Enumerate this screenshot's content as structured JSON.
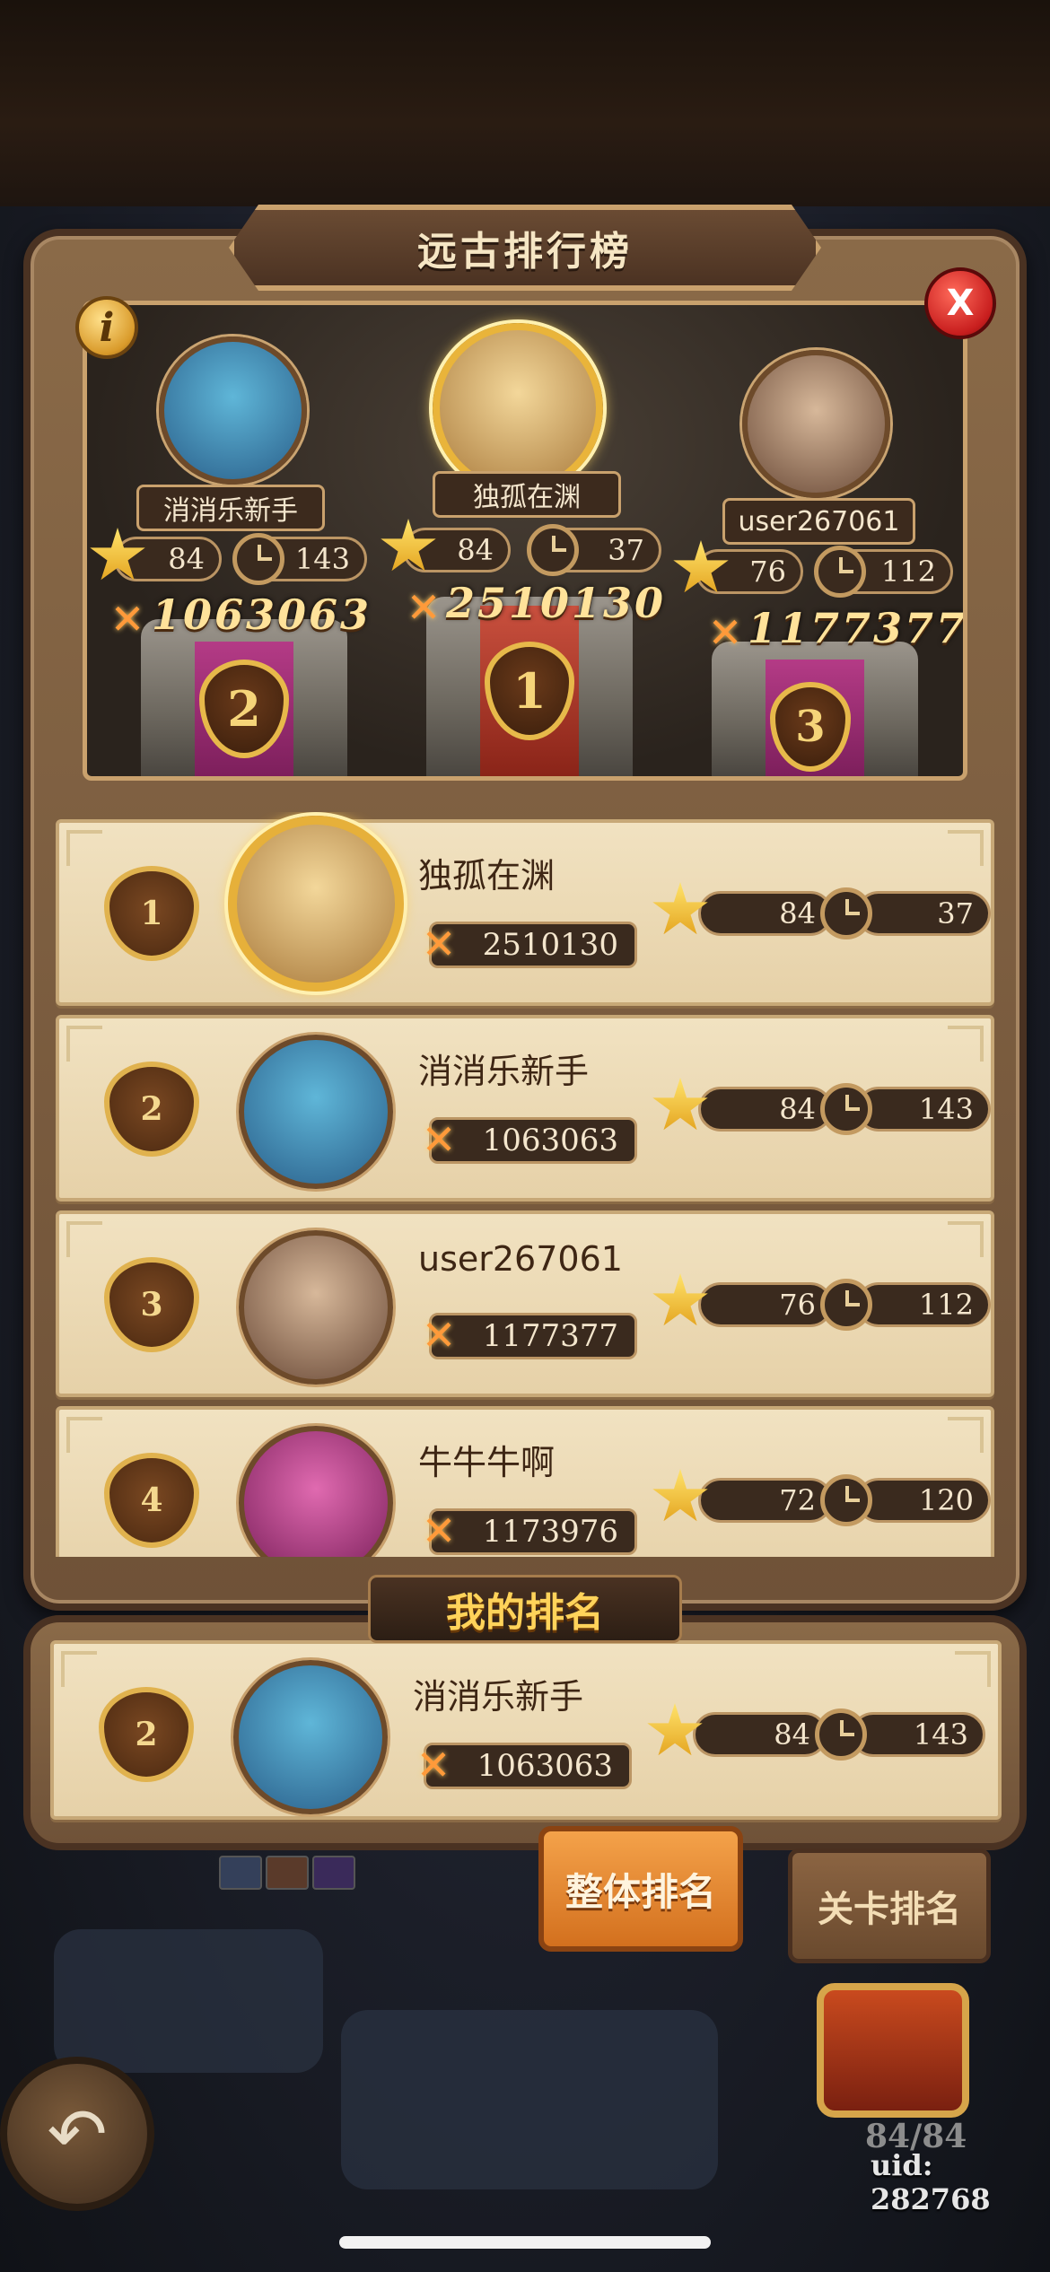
{
  "title": "远古排行榜",
  "info_label": "i",
  "close_label": "X",
  "podium": [
    {
      "rank": "2",
      "name": "消消乐新手",
      "stars": "84",
      "time": "143",
      "score": "1063063",
      "avatar_color": "#3f8fb8"
    },
    {
      "rank": "1",
      "name": "独孤在渊",
      "stars": "84",
      "time": "37",
      "score": "2510130",
      "avatar_color": "#e7c07a"
    },
    {
      "rank": "3",
      "name": "user267061",
      "stars": "76",
      "time": "112",
      "score": "1177377",
      "avatar_color": "#b99474"
    }
  ],
  "rows": [
    {
      "rank": "1",
      "name": "独孤在渊",
      "score": "2510130",
      "stars": "84",
      "time": "37",
      "avatar_color": "#e7c07a"
    },
    {
      "rank": "2",
      "name": "消消乐新手",
      "score": "1063063",
      "stars": "84",
      "time": "143",
      "avatar_color": "#3f8fb8"
    },
    {
      "rank": "3",
      "name": "user267061",
      "score": "1177377",
      "stars": "76",
      "time": "112",
      "avatar_color": "#b99474"
    },
    {
      "rank": "4",
      "name": "牛牛牛啊",
      "score": "1173976",
      "stars": "72",
      "time": "120",
      "avatar_color": "#c93f8f"
    }
  ],
  "my_rank": {
    "title": "我的排名",
    "rank": "2",
    "name": "消消乐新手",
    "score": "1063063",
    "stars": "84",
    "time": "143"
  },
  "tabs": {
    "overall": "整体排名",
    "level": "关卡排名"
  },
  "chest_count": "84/84",
  "uid": "uid: 282768",
  "back_icon": "↶"
}
